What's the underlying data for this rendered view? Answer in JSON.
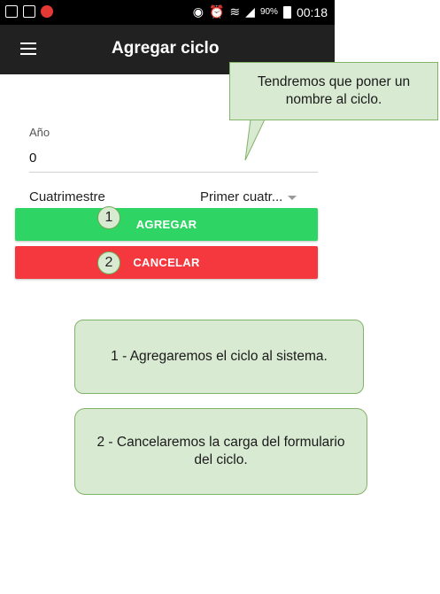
{
  "status_bar": {
    "battery_pct": "90%",
    "time": "00:18"
  },
  "app_bar": {
    "title": "Agregar ciclo",
    "menu_icon": "hamburger-menu-icon"
  },
  "form": {
    "year": {
      "label": "Año",
      "value": "0"
    },
    "cuatrimestre": {
      "label": "Cuatrimestre",
      "selected": "Primer cuatr..."
    }
  },
  "buttons": {
    "add_label": "AGREGAR",
    "cancel_label": "CANCELAR",
    "add_color": "#2fd564",
    "cancel_color": "#f5383e"
  },
  "annotations": {
    "badge_1": "1",
    "badge_2": "2",
    "callout_name": "Tendremos que poner un nombre al ciclo.",
    "callout_1": "1 - Agregaremos el ciclo al sistema.",
    "callout_2": "2 - Cancelaremos la carga del formulario del ciclo.",
    "callout_color": "#d9ead3"
  }
}
